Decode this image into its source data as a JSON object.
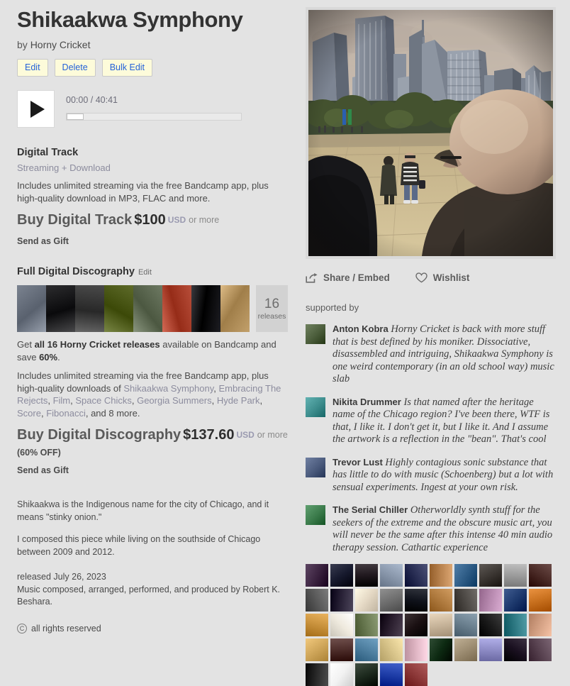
{
  "album": {
    "title": "Shikaakwa Symphony",
    "by_prefix": "by",
    "artist": "Horny Cricket"
  },
  "admin": {
    "edit": "Edit",
    "delete": "Delete",
    "bulk_edit": "Bulk Edit"
  },
  "player": {
    "play_icon": "play-icon",
    "time": "00:00 / 40:41",
    "current_time": "00:00",
    "duration": "40:41",
    "progress_percent": 0
  },
  "digital_track": {
    "heading": "Digital Track",
    "subheading": "Streaming + Download",
    "description": "Includes unlimited streaming via the free Bandcamp app, plus high-quality download in MP3, FLAC and more.",
    "buy_label": "Buy Digital Track",
    "price": "$100",
    "currency": "USD",
    "or_more": "or more",
    "gift": "Send as Gift"
  },
  "discography": {
    "heading": "Full Digital Discography",
    "edit_link": "Edit",
    "releases_count": "16",
    "releases_label": "releases",
    "get_text_prefix": "Get ",
    "get_text_bold": "all 16 Horny Cricket releases",
    "get_text_mid": " available on Bandcamp and save ",
    "get_text_bold2": "60%",
    "get_text_suffix": ".",
    "includes_prefix": "Includes unlimited streaming via the free Bandcamp app, plus high-quality downloads of ",
    "release_links": [
      "Shikaakwa Symphony",
      "Embracing The Rejects",
      "Film",
      "Space Chicks",
      "Georgia Summers",
      "Hyde Park",
      "Score",
      "Fibonacci"
    ],
    "includes_suffix": ", and 8 more.",
    "buy_label": "Buy Digital Discography",
    "price": "$137.60",
    "currency": "USD",
    "or_more": "or more",
    "discount": "(60% OFF)",
    "gift": "Send as Gift",
    "thumb_colors": [
      "#7b8390",
      "#2c2c2e",
      "#4a4a4a",
      "#5e6b2a",
      "#6e7a63",
      "#b84e3a",
      "#1d1d22",
      "#c2a06b"
    ]
  },
  "about": {
    "paragraph1": "Shikaakwa is the Indigenous name for the city of Chicago, and it means \"stinky onion.\"",
    "paragraph2": "I composed this piece while living on the southside of Chicago between 2009 and 2012."
  },
  "credits": {
    "released": "released July 26, 2023",
    "line2": "Music composed, arranged, performed, and produced by Robert K. Beshara."
  },
  "rights": {
    "icon": "copyright-icon",
    "text": "all rights reserved"
  },
  "artwork": {
    "alt": "Chicago skyline reflected in Cloud Gate with bald man in foreground",
    "sky_color": "#c9bcae",
    "plaza_color": "#c9b68a"
  },
  "actions": {
    "share": "Share / Embed",
    "share_icon": "share-icon",
    "wishlist": "Wishlist",
    "wishlist_icon": "heart-icon"
  },
  "supporters": {
    "label": "supported by",
    "reviews": [
      {
        "name": "Anton Kobra",
        "text": "Horny Cricket is back with more stuff that is best defined by his moniker. Dissociative, disassembled and intriguing, Shikaakwa Symphony is one weird contemporary (in an old school way) music slab",
        "avatar_color": "#4a5c3a"
      },
      {
        "name": "Nikita Drummer",
        "text": "Is that named after the heritage name of the Chicago region? I've been there, WTF is that, I like it. I don't get it, but I like it. And I assume the artwork is a reflection in the \"bean\". That's cool",
        "avatar_color": "#3c8c8c"
      },
      {
        "name": "Trevor Lust",
        "text": "Highly contagious sonic substance that has little to do with music (Schoenberg) but a lot with sensual experiments. Ingest at your own risk.",
        "avatar_color": "#4a5a7c"
      },
      {
        "name": "The Serial Chiller",
        "text": "Otherworldly synth stuff for the seekers of the extreme and the obscure music art, you will never be the same after this intense 40 min audio therapy session. Cathartic experience",
        "avatar_color": "#3a7a4a"
      }
    ],
    "fan_avatar_colors": [
      "#3b2340",
      "#171a2e",
      "#20181e",
      "#8a98ac",
      "#2a2f55",
      "#b9834f",
      "#2e5c86",
      "#3b3632",
      "#9c9c9c",
      "#4a2a26",
      "#5a5a5a",
      "#2a2338",
      "#e4d8c4",
      "#6e6e6e",
      "#10131c",
      "#b07b3f",
      "#4e4a46",
      "#b88ab0",
      "#1e3a6e",
      "#c8701e",
      "#c8913c",
      "#efeade",
      "#6a7a52",
      "#2c2030",
      "#1a1012",
      "#c7b49a",
      "#6a7f8e",
      "#1b1b1b",
      "#2f7a84",
      "#d4a184",
      "#cfa65a",
      "#4d2d2a",
      "#4e7fa0",
      "#d8c48a",
      "#e0b6c4",
      "#0d2a12",
      "#9d8d72",
      "#8e8cc6",
      "#1a1020",
      "#5a4452",
      "#2a2a2a",
      "#f2f2f2",
      "#1d2a1e",
      "#1f3ea8",
      "#8e3a3a"
    ]
  }
}
